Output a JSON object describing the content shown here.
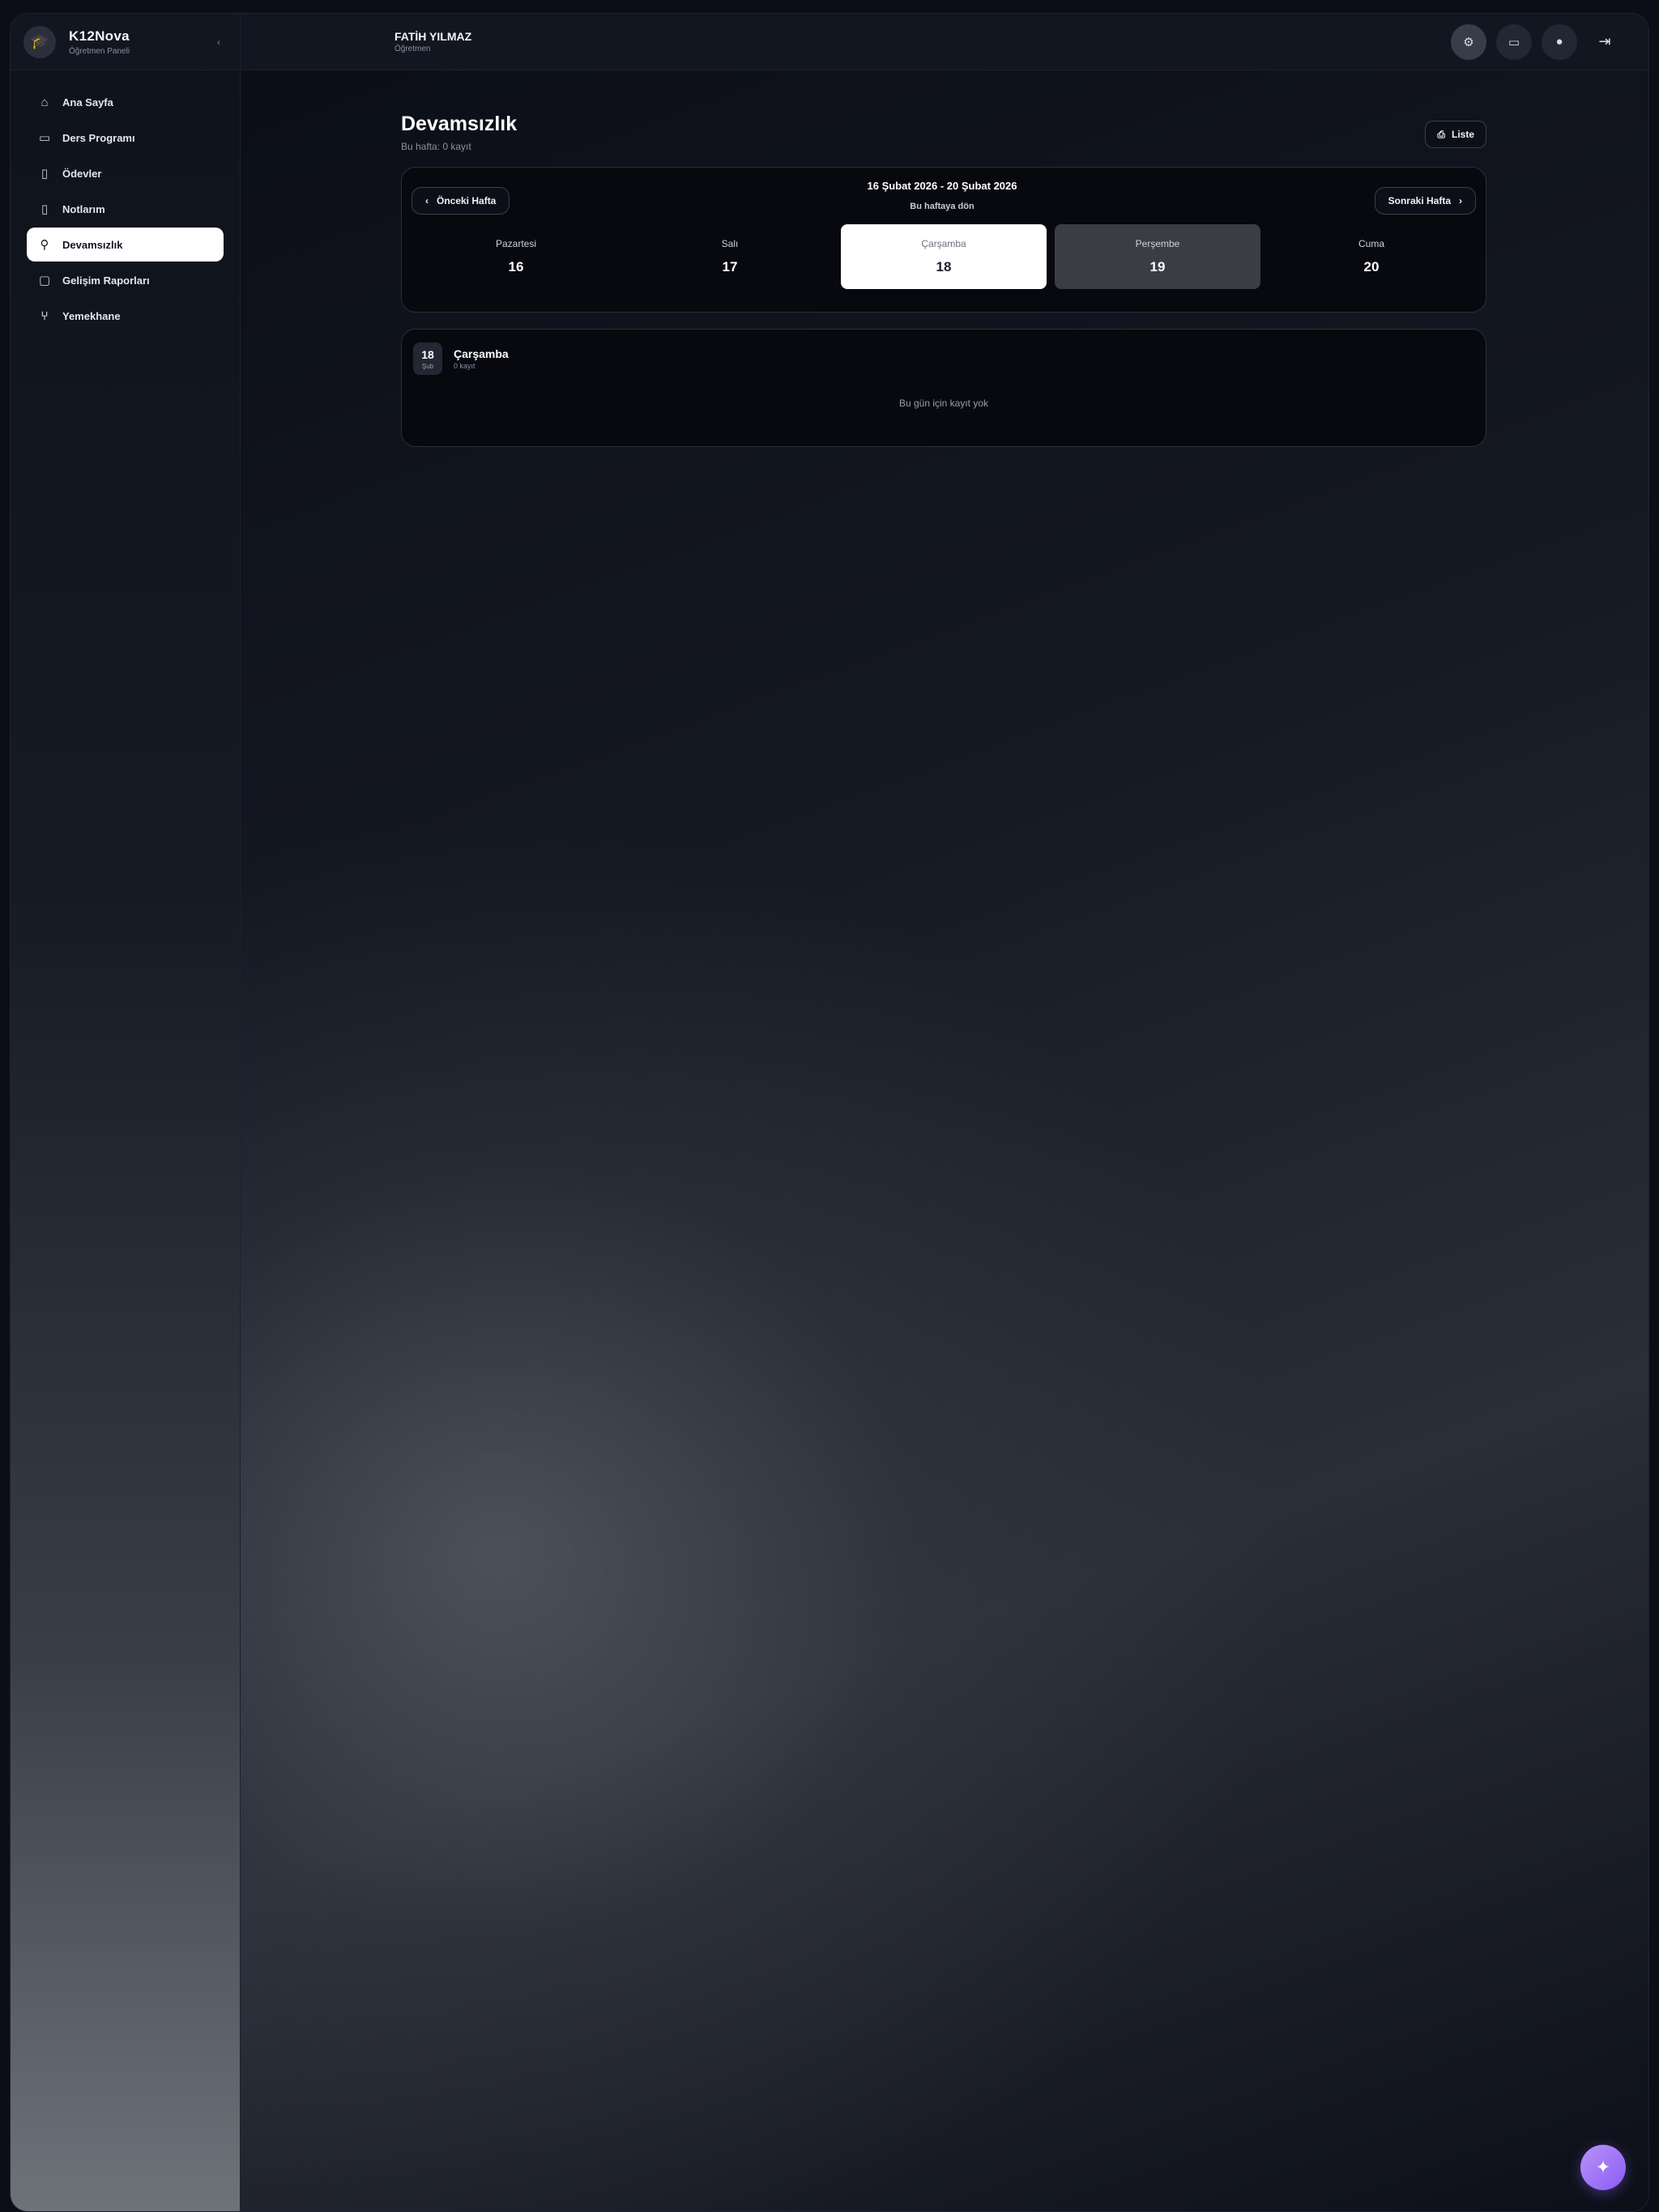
{
  "brand": {
    "name": "K12Nova",
    "subtitle": "Öğretmen Paneli",
    "logo_icon": "graduation-cap-icon"
  },
  "sidebar": {
    "items": [
      {
        "label": "Ana Sayfa",
        "icon": "home-icon"
      },
      {
        "label": "Ders Programı",
        "icon": "calendar-icon"
      },
      {
        "label": "Ödevler",
        "icon": "book-icon"
      },
      {
        "label": "Notlarım",
        "icon": "note-icon"
      },
      {
        "label": "Devamsızlık",
        "icon": "user-check-icon",
        "active": true
      },
      {
        "label": "Gelişim Raporları",
        "icon": "file-icon"
      },
      {
        "label": "Yemekhane",
        "icon": "utensils-icon"
      }
    ]
  },
  "topbar": {
    "user_name": "FATİH YILMAZ",
    "user_role": "Öğretmen",
    "actions": [
      "settings-icon",
      "monitor-icon",
      "globe-icon",
      "logout-icon"
    ]
  },
  "page": {
    "title": "Devamsızlık",
    "subtitle": "Bu hafta: 0 kayıt",
    "export_label": "Liste"
  },
  "week": {
    "prev_label": "Önceki Hafta",
    "next_label": "Sonraki Hafta",
    "range": "16 Şubat 2026 - 20 Şubat 2026",
    "label": "Bu haftaya dön",
    "days": [
      {
        "name": "Pazartesi",
        "num": "16"
      },
      {
        "name": "Salı",
        "num": "17"
      },
      {
        "name": "Çarşamba",
        "num": "18"
      },
      {
        "name": "Perşembe",
        "num": "19"
      },
      {
        "name": "Cuma",
        "num": "20"
      }
    ]
  },
  "day_detail": {
    "chip_num": "18",
    "chip_month": "Şub",
    "title": "Çarşamba",
    "count": "0 kayıt",
    "empty": "Bu gün için kayıt yok"
  },
  "colors": {
    "accent": "#8b5cf6",
    "active_bg": "#ffffff",
    "card_bg": "#07090e"
  }
}
